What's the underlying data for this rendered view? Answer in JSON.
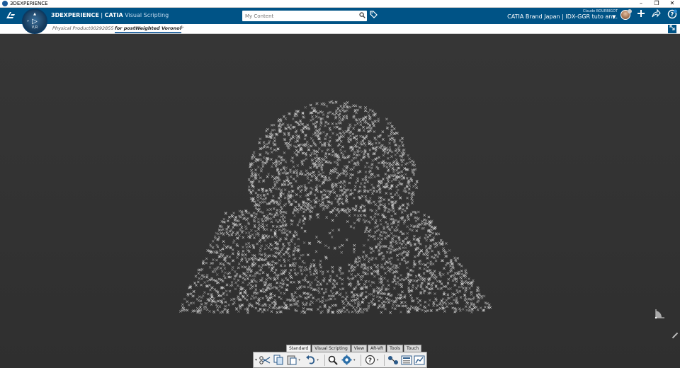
{
  "window": {
    "title": "3DEXPERIENCE",
    "controls": [
      "–",
      "❐",
      "✕"
    ]
  },
  "topbar": {
    "brand_bold": "3DEXPERIENCE",
    "brand_sep": " | ",
    "brand_catia": "CATIA",
    "app_name": " Visual Scripting",
    "compass_label": "V,R",
    "search_placeholder": "My Content",
    "user_name": "Claude BOURBIGOT",
    "collab_space": "CATIA Brand Japan | IDX-GGR tuto an...",
    "icons": [
      "ds-logo-icon",
      "compass-icon",
      "search-icon",
      "tag-icon",
      "avatar",
      "add-icon",
      "share-icon",
      "help-icon"
    ]
  },
  "tabs": {
    "items": [
      {
        "label": "Physical Product00292855",
        "active": false
      },
      {
        "label": "for postWeighted Voronoi",
        "active": true
      }
    ],
    "add_label": "+"
  },
  "action_bar": {
    "tabs": [
      {
        "label": "Standard",
        "active": true
      },
      {
        "label": "Visual Scripting",
        "active": false
      },
      {
        "label": "View",
        "active": false
      },
      {
        "label": "AR-VR",
        "active": false
      },
      {
        "label": "Tools",
        "active": false
      },
      {
        "label": "Touch",
        "active": false
      }
    ],
    "tools": [
      "cut-icon",
      "copy-icon",
      "paste-icon",
      "undo-icon",
      "zoom-icon",
      "settings-icon",
      "help-icon",
      "nodes-icon",
      "panel-icon",
      "chart-icon"
    ]
  },
  "colors": {
    "topbar": "#005386",
    "viewport": "#333333",
    "points": "#d8d8d8"
  }
}
